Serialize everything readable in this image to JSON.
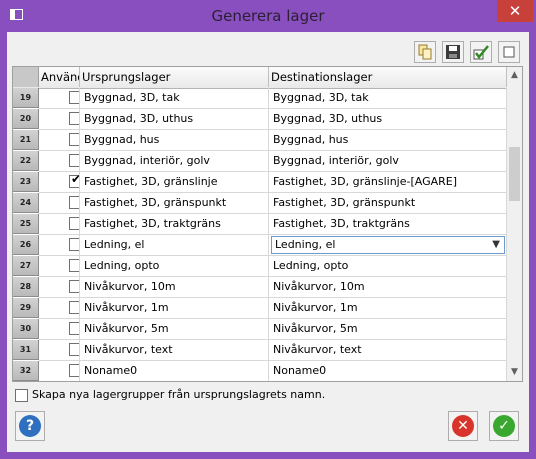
{
  "window": {
    "title": "Generera lager",
    "close_label": "✕"
  },
  "toolbar": {
    "icons": [
      "copy-icon",
      "save-icon",
      "check-all-icon",
      "uncheck-icon"
    ]
  },
  "grid": {
    "columns": [
      "Använd",
      "Ursprungslager",
      "Destinationslager"
    ],
    "rows": [
      {
        "num": "19",
        "checked": false,
        "src": "Byggnad, 3D, tak",
        "dst": "Byggnad, 3D, tak"
      },
      {
        "num": "20",
        "checked": false,
        "src": "Byggnad, 3D, uthus",
        "dst": "Byggnad, 3D, uthus"
      },
      {
        "num": "21",
        "checked": false,
        "src": "Byggnad, hus",
        "dst": "Byggnad, hus"
      },
      {
        "num": "22",
        "checked": false,
        "src": "Byggnad, interiör, golv",
        "dst": "Byggnad, interiör, golv"
      },
      {
        "num": "23",
        "checked": true,
        "src": "Fastighet, 3D, gränslinje",
        "dst": "Fastighet, 3D, gränslinje-[AGARE]"
      },
      {
        "num": "24",
        "checked": false,
        "src": "Fastighet, 3D, gränspunkt",
        "dst": "Fastighet, 3D, gränspunkt"
      },
      {
        "num": "25",
        "checked": false,
        "src": "Fastighet, 3D, traktgräns",
        "dst": "Fastighet, 3D, traktgräns"
      },
      {
        "num": "26",
        "checked": false,
        "src": "Ledning, el",
        "dst": "Ledning, el",
        "editing": true
      },
      {
        "num": "27",
        "checked": false,
        "src": "Ledning, opto",
        "dst": "Ledning, opto"
      },
      {
        "num": "28",
        "checked": false,
        "src": "Nivåkurvor, 10m",
        "dst": "Nivåkurvor, 10m"
      },
      {
        "num": "29",
        "checked": false,
        "src": "Nivåkurvor, 1m",
        "dst": "Nivåkurvor, 1m"
      },
      {
        "num": "30",
        "checked": false,
        "src": "Nivåkurvor, 5m",
        "dst": "Nivåkurvor, 5m"
      },
      {
        "num": "31",
        "checked": false,
        "src": "Nivåkurvor, text",
        "dst": "Nivåkurvor, text"
      },
      {
        "num": "32",
        "checked": false,
        "src": "Noname0",
        "dst": "Noname0"
      }
    ]
  },
  "options": {
    "create_groups_label": "Skapa nya lagergrupper från ursprungslagrets namn.",
    "create_groups_checked": false
  },
  "buttons": {
    "help": "?",
    "cancel": "✕",
    "ok": "✓"
  },
  "colors": {
    "titlebar": "#8a4fbf",
    "close": "#c7403a",
    "cancel": "#d9342b",
    "ok": "#3aa82f",
    "help": "#2f6fc0"
  }
}
